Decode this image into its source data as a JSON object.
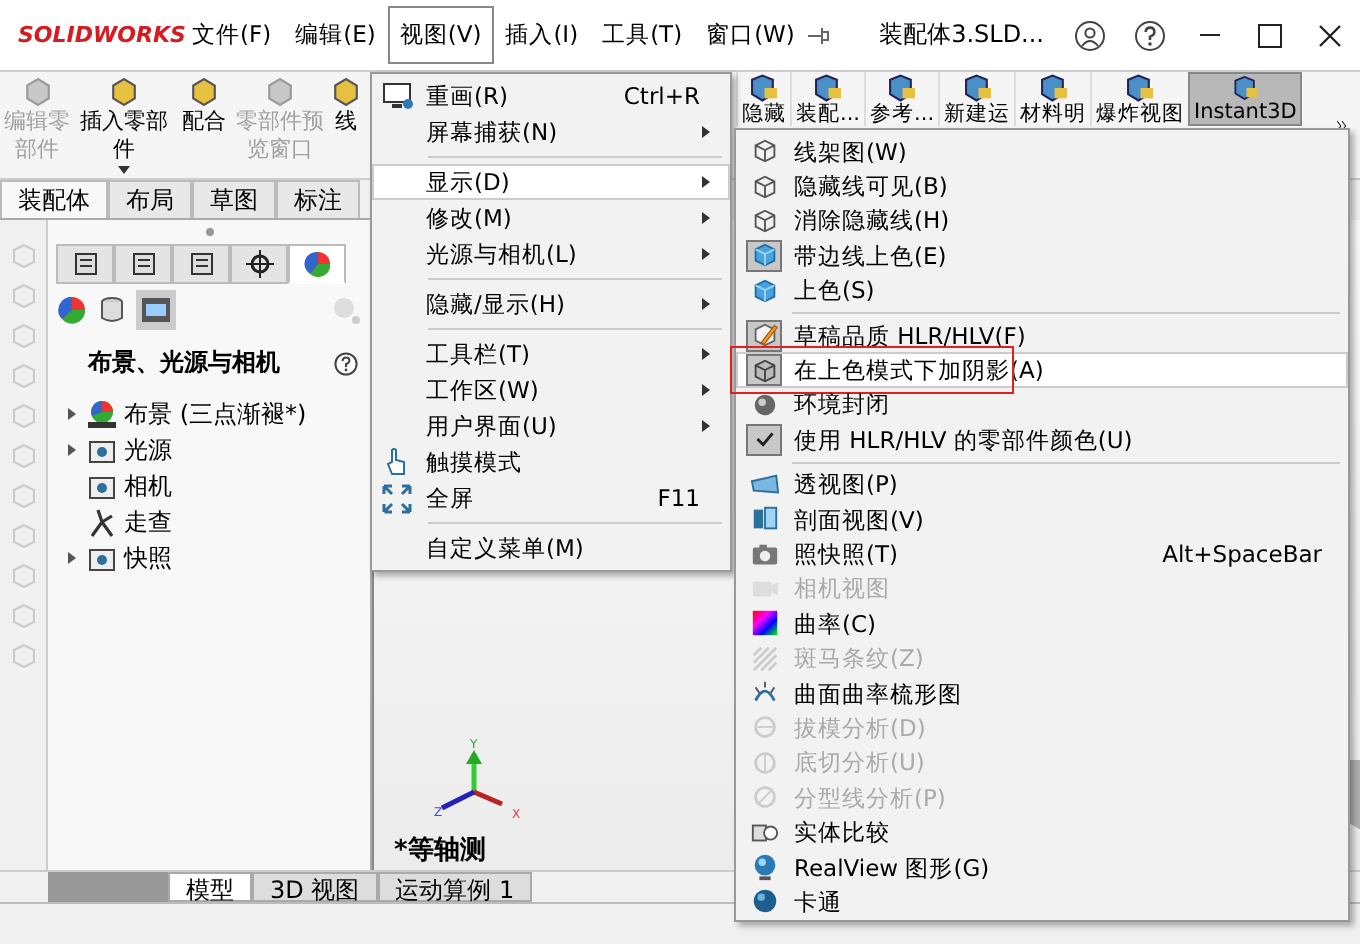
{
  "window": {
    "title": "装配体3.SLD..."
  },
  "app_logo": "SOLIDWORKS",
  "menu_bar": [
    {
      "label": "文件(F)",
      "selected": false
    },
    {
      "label": "编辑(E)",
      "selected": false
    },
    {
      "label": "视图(V)",
      "selected": true
    },
    {
      "label": "插入(I)",
      "selected": false
    },
    {
      "label": "工具(T)",
      "selected": false
    },
    {
      "label": "窗口(W)",
      "selected": false
    }
  ],
  "toolbar_left": [
    {
      "label": "编辑零部件",
      "disabled": true,
      "dropdown": false
    },
    {
      "label": "插入零部件",
      "disabled": false,
      "dropdown": true
    },
    {
      "label": "配合",
      "disabled": false,
      "dropdown": false
    },
    {
      "label": "零部件预览窗口",
      "disabled": true,
      "dropdown": false
    },
    {
      "label": "线",
      "disabled": false,
      "dropdown": false
    }
  ],
  "toolbar_right": [
    {
      "label": "隐藏",
      "selected": false
    },
    {
      "label": "装配...",
      "selected": false
    },
    {
      "label": "参考...",
      "selected": false
    },
    {
      "label": "新建运",
      "selected": false
    },
    {
      "label": "材料明",
      "selected": false
    },
    {
      "label": "爆炸视图",
      "selected": false
    },
    {
      "label": "Instant3D",
      "selected": true
    }
  ],
  "command_tabs": [
    {
      "label": "装配体",
      "selected": true
    },
    {
      "label": "布局",
      "selected": false
    },
    {
      "label": "草图",
      "selected": false
    },
    {
      "label": "标注",
      "selected": false
    }
  ],
  "panel": {
    "tabs": [
      {
        "selected": false
      },
      {
        "selected": false
      },
      {
        "selected": false
      },
      {
        "selected": false
      },
      {
        "selected": true
      }
    ],
    "title": "布景、光源与相机",
    "tree": [
      {
        "label": "布景 (三点渐褪*)",
        "kind": "group"
      },
      {
        "label": "光源",
        "kind": "group"
      },
      {
        "label": "相机",
        "kind": "leaf"
      },
      {
        "label": "走查",
        "kind": "leaf"
      },
      {
        "label": "快照",
        "kind": "group"
      }
    ]
  },
  "viewport": {
    "view_label": "*等轴测",
    "axes": [
      "Y",
      "Z",
      "X"
    ]
  },
  "bottom_tabs": [
    {
      "label": "模型",
      "selected": true
    },
    {
      "label": "3D 视图",
      "selected": false
    },
    {
      "label": "运动算例 1",
      "selected": false
    }
  ],
  "view_menu": [
    {
      "kind": "item",
      "label": "重画(R)",
      "shortcut": "Ctrl+R",
      "submenu": false,
      "selected": false
    },
    {
      "kind": "item",
      "label": "屏幕捕获(N)",
      "submenu": true,
      "selected": false
    },
    {
      "kind": "separator"
    },
    {
      "kind": "item",
      "label": "显示(D)",
      "submenu": true,
      "selected": true
    },
    {
      "kind": "item",
      "label": "修改(M)",
      "submenu": true,
      "selected": false
    },
    {
      "kind": "item",
      "label": "光源与相机(L)",
      "submenu": true,
      "selected": false
    },
    {
      "kind": "separator"
    },
    {
      "kind": "item",
      "label": "隐藏/显示(H)",
      "submenu": true,
      "selected": false
    },
    {
      "kind": "separator"
    },
    {
      "kind": "item",
      "label": "工具栏(T)",
      "submenu": true,
      "selected": false
    },
    {
      "kind": "item",
      "label": "工作区(W)",
      "submenu": true,
      "selected": false
    },
    {
      "kind": "item",
      "label": "用户界面(U)",
      "submenu": true,
      "selected": false
    },
    {
      "kind": "item",
      "label": "触摸模式",
      "submenu": false,
      "selected": false
    },
    {
      "kind": "item",
      "label": "全屏",
      "shortcut": "F11",
      "submenu": false,
      "selected": false
    },
    {
      "kind": "separator"
    },
    {
      "kind": "item",
      "label": "自定义菜单(M)",
      "submenu": false,
      "selected": false
    }
  ],
  "display_menu": [
    {
      "kind": "command",
      "label": "线架图(W)",
      "checked": false,
      "disabled": false,
      "selected": false
    },
    {
      "kind": "command",
      "label": "隐藏线可见(B)",
      "checked": false,
      "disabled": false,
      "selected": false
    },
    {
      "kind": "command",
      "label": "消除隐藏线(H)",
      "checked": false,
      "disabled": false,
      "selected": false
    },
    {
      "kind": "command",
      "label": "带边线上色(E)",
      "checked": true,
      "disabled": false,
      "selected": false
    },
    {
      "kind": "command",
      "label": "上色(S)",
      "checked": false,
      "disabled": false,
      "selected": false
    },
    {
      "kind": "separator"
    },
    {
      "kind": "command",
      "label": "草稿品质 HLR/HLV(F)",
      "checked": true,
      "disabled": false,
      "selected": false
    },
    {
      "kind": "command",
      "label": "在上色模式下加阴影(A)",
      "checked": true,
      "disabled": false,
      "selected": true
    },
    {
      "kind": "command",
      "label": "环境封闭",
      "checked": false,
      "disabled": false,
      "selected": false
    },
    {
      "kind": "checkbox",
      "label": "使用 HLR/HLV 的零部件颜色(U)",
      "checked": true,
      "disabled": false,
      "selected": false
    },
    {
      "kind": "separator"
    },
    {
      "kind": "command",
      "label": "透视图(P)",
      "checked": false,
      "disabled": false,
      "selected": false
    },
    {
      "kind": "command",
      "label": "剖面视图(V)",
      "checked": false,
      "disabled": false,
      "selected": false
    },
    {
      "kind": "command",
      "label": "照快照(T)",
      "shortcut": "Alt+SpaceBar",
      "checked": false,
      "disabled": false,
      "selected": false
    },
    {
      "kind": "command",
      "label": "相机视图",
      "checked": false,
      "disabled": true,
      "selected": false
    },
    {
      "kind": "command",
      "label": "曲率(C)",
      "checked": false,
      "disabled": false,
      "selected": false
    },
    {
      "kind": "command",
      "label": "斑马条纹(Z)",
      "checked": false,
      "disabled": true,
      "selected": false
    },
    {
      "kind": "command",
      "label": "曲面曲率梳形图",
      "checked": false,
      "disabled": false,
      "selected": false
    },
    {
      "kind": "command",
      "label": "拔模分析(D)",
      "checked": false,
      "disabled": true,
      "selected": false
    },
    {
      "kind": "command",
      "label": "底切分析(U)",
      "checked": false,
      "disabled": true,
      "selected": false
    },
    {
      "kind": "command",
      "label": "分型线分析(P)",
      "checked": false,
      "disabled": true,
      "selected": false
    },
    {
      "kind": "command",
      "label": "实体比较",
      "checked": false,
      "disabled": false,
      "selected": false
    },
    {
      "kind": "command",
      "label": "RealView 图形(G)",
      "checked": false,
      "disabled": false,
      "selected": false
    },
    {
      "kind": "command",
      "label": "卡通",
      "checked": false,
      "disabled": false,
      "selected": false
    }
  ]
}
